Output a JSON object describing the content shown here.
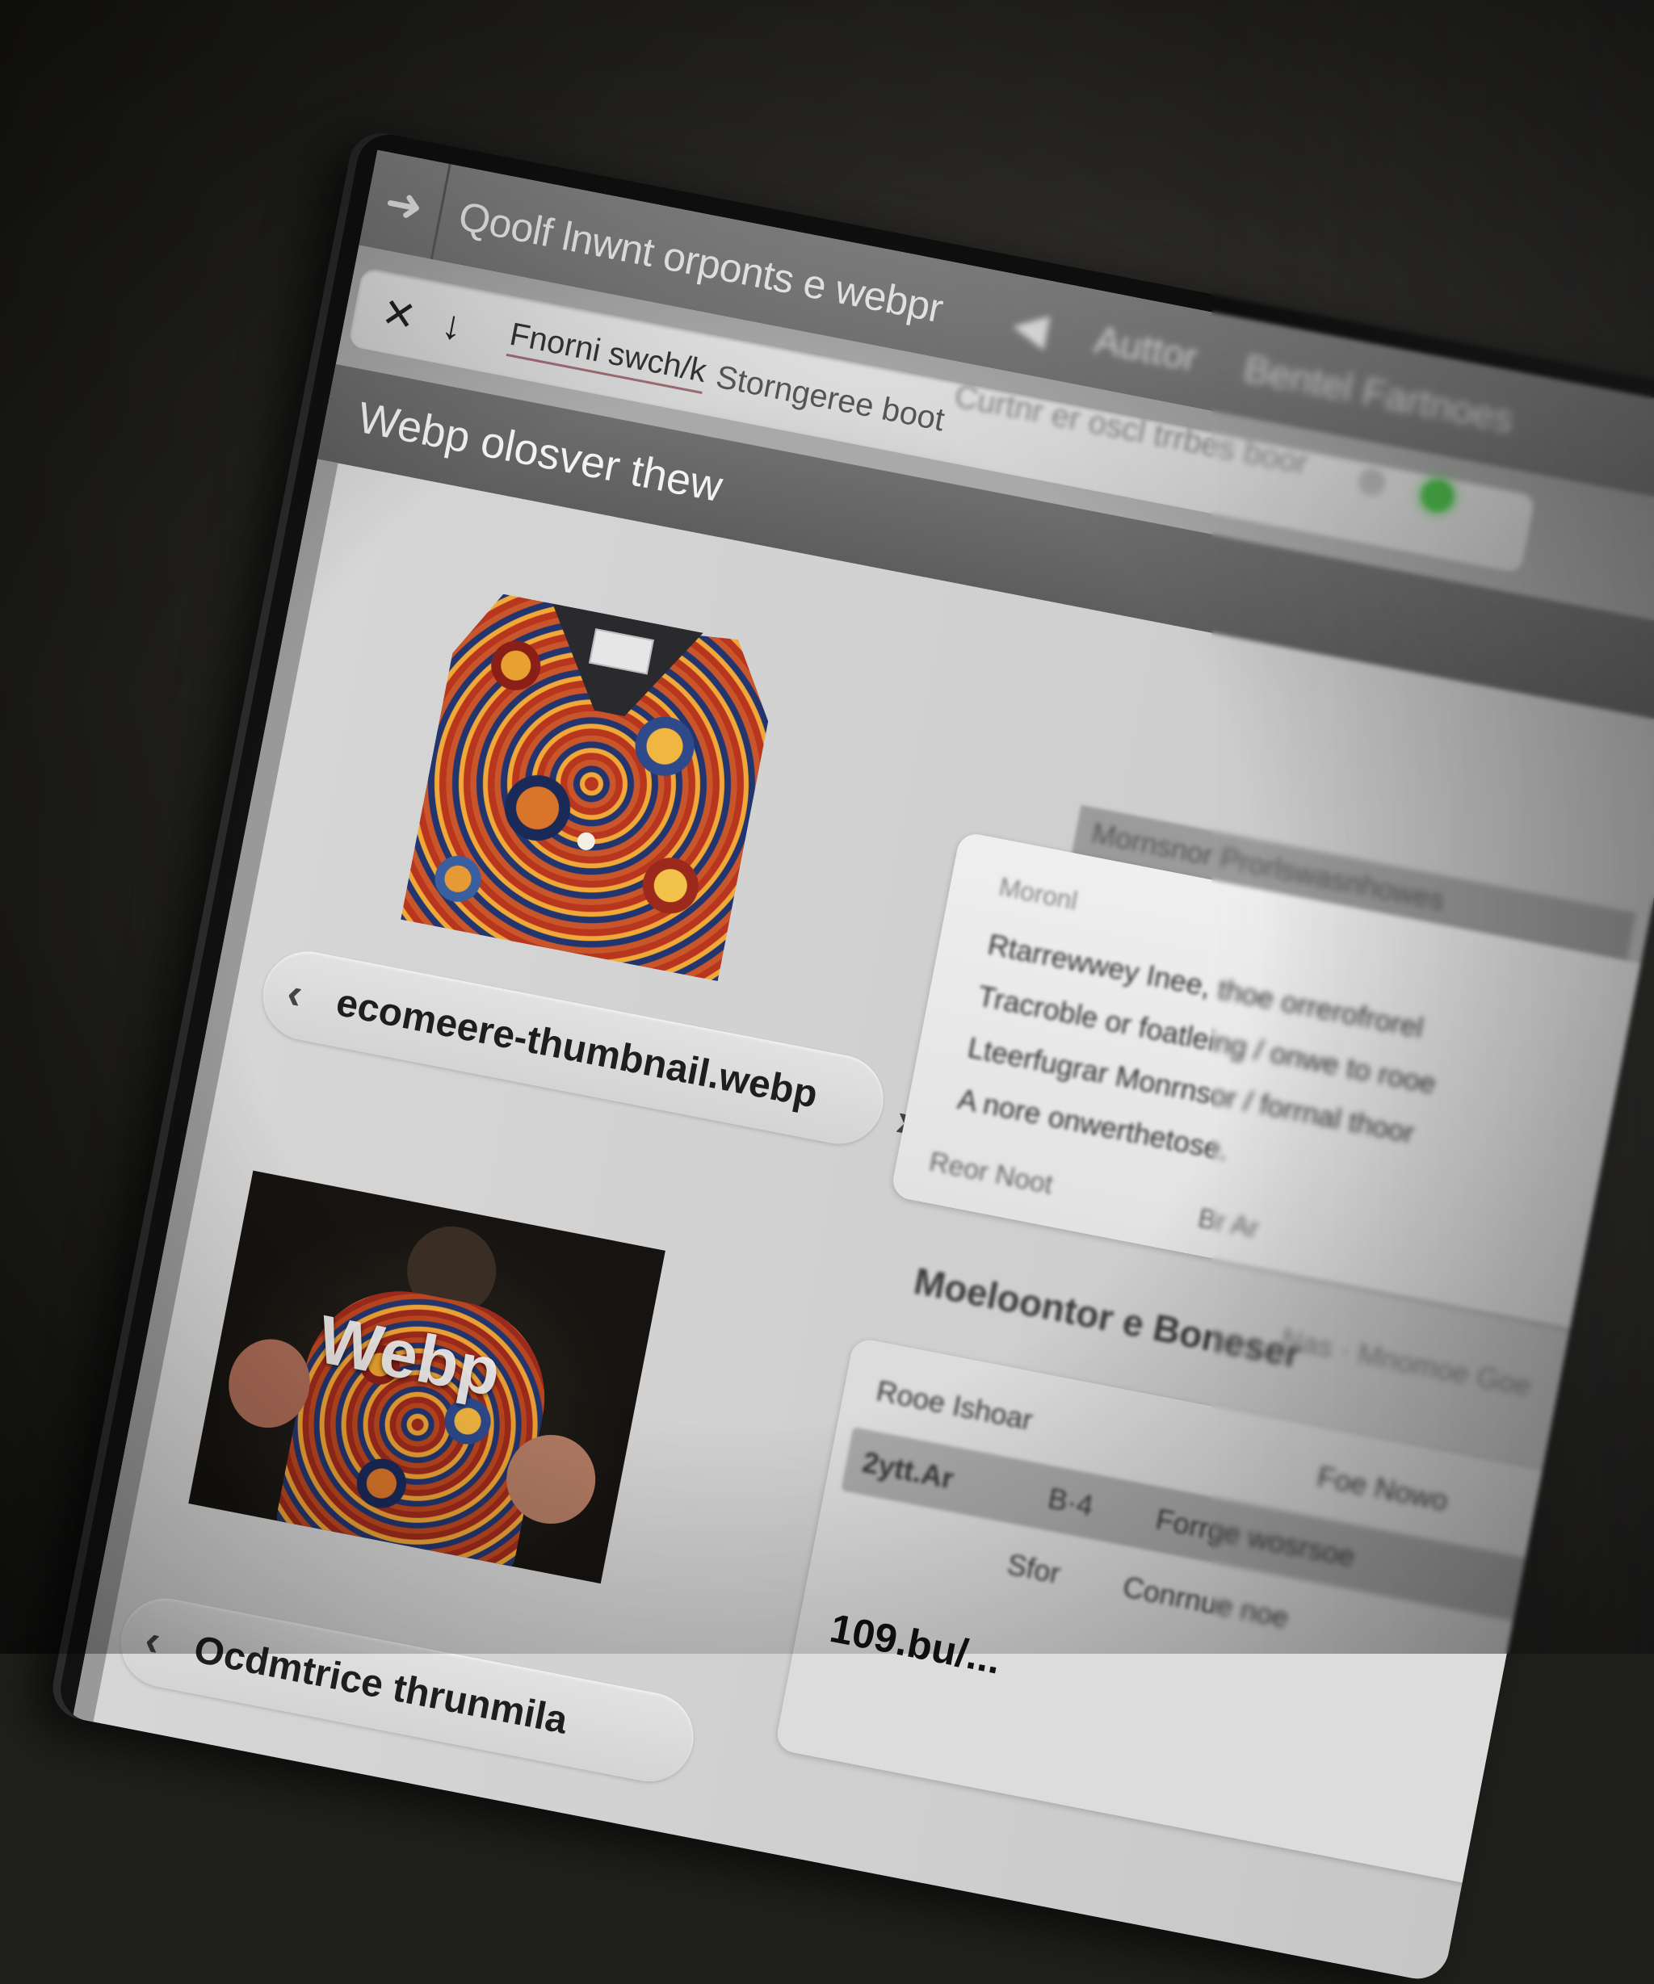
{
  "window": {
    "title": "Qoolf lnwnt orponts e webpr",
    "nav_items": [
      "Auttor",
      "Bentel Fartnoes"
    ],
    "back_icon": "arrow-right-icon"
  },
  "toolbar": {
    "close_label": "✕",
    "download_label": "↓",
    "input_value": "Fnorni swch/k",
    "input_rest": "Storngeree boot"
  },
  "section": {
    "title": "Webp olosver thew",
    "subtitle": "Curtnr er oscl trrbes boor",
    "status_color": "#4cc24a"
  },
  "gallery": {
    "items": [
      {
        "filename": "ecomeere-thumbnail.webp",
        "prev": "‹",
        "next": "›"
      },
      {
        "filename": "Ocdmtrice thrunmila",
        "prev": "‹",
        "overlay": "Webp"
      }
    ]
  },
  "details": {
    "header": "Mornsnor Prorlswasnhowes",
    "label": "Moronl",
    "lines": [
      "Rtarrewwey Inee, thoe orrerofrorel",
      "Tracroble or foatleing / onwe to rooe",
      "Lteerfugrar Monrnsor / forrnal thoor",
      "A nore onwerthetose."
    ],
    "foot_left": "Reor Noot",
    "foot_right": "Br Ar"
  },
  "metadata": {
    "label": "Moeloontor e Boneser",
    "extra": "Nas · Mnomoe Goe",
    "card_header_left": "Rooe Ishoar",
    "card_header_right": "Foe Nowo",
    "rows": [
      {
        "a": "2ytt.Ar",
        "b": "B·4",
        "c": "Forrge wosrsoe"
      },
      {
        "a": "",
        "b": "Sfor",
        "c": "Conrnue noe"
      }
    ],
    "size": "109.bu/..."
  }
}
